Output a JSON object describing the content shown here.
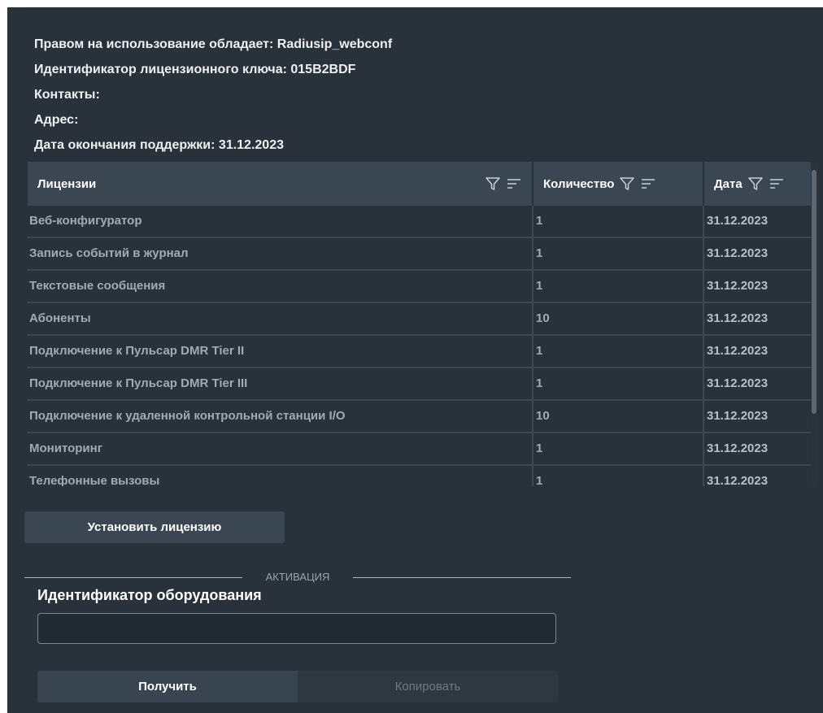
{
  "info": {
    "owner": "Правом на использование обладает: Radiusip_webconf",
    "license_key": "Идентификатор лицензионного ключа: 015B2BDF",
    "contacts": "Контакты:",
    "address": "Адрес:",
    "support_end": "Дата окончания поддержки: 31.12.2023"
  },
  "table": {
    "columns": {
      "license": "Лицензии",
      "quantity": "Количество",
      "date": "Дата"
    },
    "rows": [
      {
        "license": "Веб-конфигуратор",
        "quantity": "1",
        "date": "31.12.2023"
      },
      {
        "license": "Запись событий в журнал",
        "quantity": "1",
        "date": "31.12.2023"
      },
      {
        "license": "Текстовые сообщения",
        "quantity": "1",
        "date": "31.12.2023"
      },
      {
        "license": "Абоненты",
        "quantity": "10",
        "date": "31.12.2023"
      },
      {
        "license": "Подключение к Пульсар DMR Tier II",
        "quantity": "1",
        "date": "31.12.2023"
      },
      {
        "license": "Подключение к Пульсар DMR Tier III",
        "quantity": "1",
        "date": "31.12.2023"
      },
      {
        "license": "Подключение к удаленной контрольной станции I/O",
        "quantity": "10",
        "date": "31.12.2023"
      },
      {
        "license": "Мониторинг",
        "quantity": "1",
        "date": "31.12.2023"
      },
      {
        "license": "Телефонные вызовы",
        "quantity": "1",
        "date": "31.12.2023"
      }
    ]
  },
  "actions": {
    "install_license": "Установить лицензию"
  },
  "activation": {
    "section_title": "АКТИВАЦИЯ",
    "hardware_id_label": "Идентификатор оборудования",
    "hardware_id_value": "",
    "get_label": "Получить",
    "copy_label": "Копировать"
  },
  "icons": {
    "filter": "filter-icon",
    "sort": "sort-icon"
  },
  "colors": {
    "panel_bg": "#29323b",
    "header_bg": "#3a4652",
    "cell_text": "#a2aab2"
  }
}
